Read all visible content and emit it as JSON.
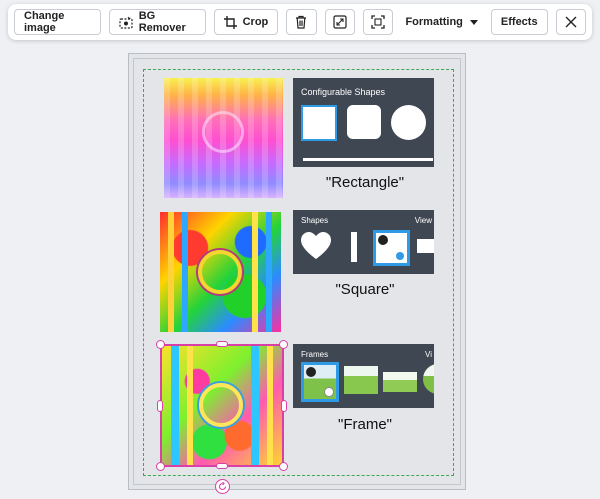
{
  "toolbar": {
    "change_image": "Change image",
    "bg_remover": "BG Remover",
    "crop": "Crop",
    "formatting": "Formatting",
    "effects": "Effects"
  },
  "panels": {
    "configurable_title": "Configurable Shapes",
    "shapes_title": "Shapes",
    "shapes_view": "View",
    "frames_title": "Frames",
    "frames_view": "Vi"
  },
  "captions": {
    "rectangle": "\"Rectangle\"",
    "square": "\"Square\"",
    "frame": "\"Frame\""
  },
  "colors": {
    "selection": "#d83fa7",
    "guide": "#3aa856",
    "panel_bg": "#3e4752",
    "highlight": "#2f9be6"
  }
}
